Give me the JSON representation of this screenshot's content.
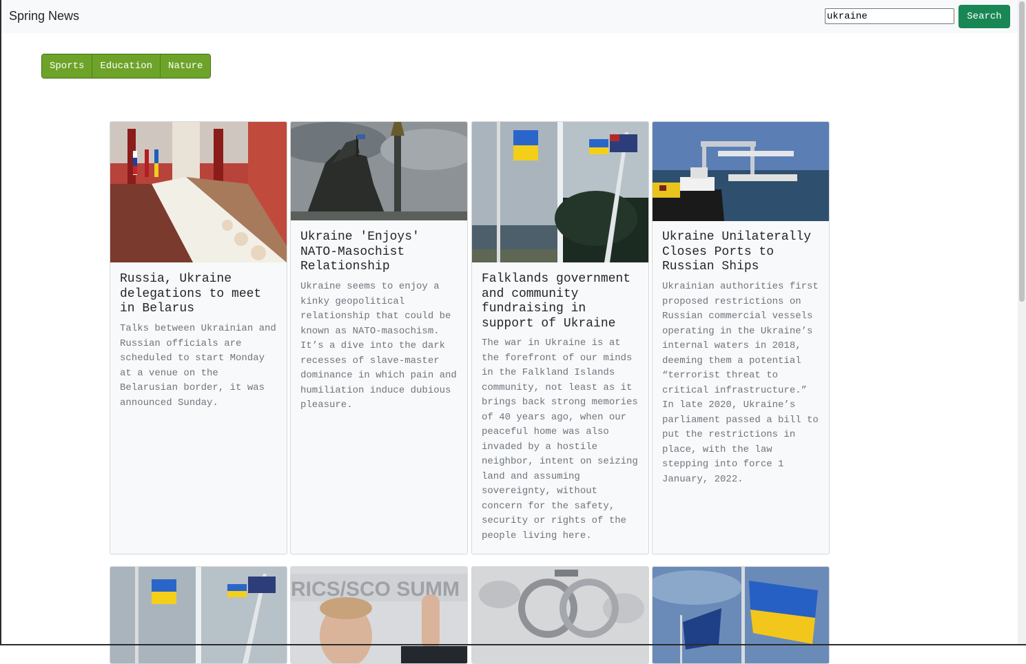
{
  "navbar": {
    "brand": "Spring News",
    "search_value": "ukraine",
    "search_button": "Search"
  },
  "categories": [
    "Sports",
    "Education",
    "Nature"
  ],
  "articles": [
    {
      "title": "Russia, Ukraine delegations to meet in Belarus",
      "text": "Talks between Ukrainian and Russian officials are scheduled to start Monday at a venue on the Belarusian border, it was announced Sunday.",
      "image": "conference-room-image"
    },
    {
      "title": "Ukraine 'Enjoys' NATO-Masochist Relationship",
      "text": "Ukraine seems to enjoy a kinky geopolitical relationship that could be known as NATO-masochism. It’s a dive into the dark recesses of slave-master dominance in which pain and humiliation induce dubious pleasure.",
      "image": "statue-monument-image"
    },
    {
      "title": "Falklands government and community fundraising in support of Ukraine",
      "text": "The war in Ukraine is at the forefront of our minds in the Falkland Islands community, not least as it brings back strong memories of 40 years ago, when our peaceful home was also invaded by a hostile neighbor, intent on seizing land and assuming sovereignty, without concern for the safety, security or rights of the people living here.",
      "image": "flags-collage-image"
    },
    {
      "title": "Ukraine Unilaterally Closes Ports to Russian Ships",
      "text": "Ukrainian authorities first proposed restrictions on Russian commercial vessels operating in the Ukraine’s internal waters in 2018, deeming them a potential “terrorist threat to critical infrastructure.” In late 2020, Ukraine’s parliament passed a bill to put the restrictions in place, with the law stepping into force 1 January, 2022.",
      "image": "port-ships-image"
    },
    {
      "image": "flags-collage-image"
    },
    {
      "image": "summit-speaker-image"
    },
    {
      "image": "handcuffs-image"
    },
    {
      "image": "nato-ukraine-flags-image"
    }
  ],
  "colors": {
    "search_button": "#198754",
    "category_button": "#6ea32a",
    "card_background": "#f8f9fa"
  }
}
